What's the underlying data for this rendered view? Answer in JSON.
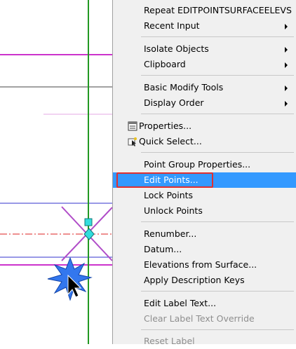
{
  "context_menu": {
    "items": [
      {
        "label": "Repeat EDITPOINTSURFACEELEVS"
      },
      {
        "label": "Recent Input",
        "submenu": true
      },
      {
        "label": "Isolate Objects",
        "submenu": true
      },
      {
        "label": "Clipboard",
        "submenu": true
      },
      {
        "label": "Basic Modify Tools",
        "submenu": true
      },
      {
        "label": "Display Order",
        "submenu": true
      },
      {
        "label": "Properties...",
        "icon": "properties-icon"
      },
      {
        "label": "Quick Select...",
        "icon": "quick-select-icon"
      },
      {
        "label": "Point Group Properties..."
      },
      {
        "label": "Edit Points...",
        "highlighted": true
      },
      {
        "label": "Lock Points"
      },
      {
        "label": "Unlock Points"
      },
      {
        "label": "Renumber..."
      },
      {
        "label": "Datum..."
      },
      {
        "label": "Elevations from Surface..."
      },
      {
        "label": "Apply Description Keys"
      },
      {
        "label": "Edit Label Text..."
      },
      {
        "label": "Clear Label Text Override",
        "disabled": true
      },
      {
        "label": "Reset Label",
        "disabled": true
      }
    ]
  },
  "colors": {
    "highlight": "#3399ff",
    "outline": "#e03030",
    "magenta_line": "#cc33cc",
    "green_line": "#229922",
    "blue_line": "#3333cc",
    "red_dash": "#dd2222",
    "grip": "#33dddd",
    "cursor_burst": "#3377ee"
  }
}
